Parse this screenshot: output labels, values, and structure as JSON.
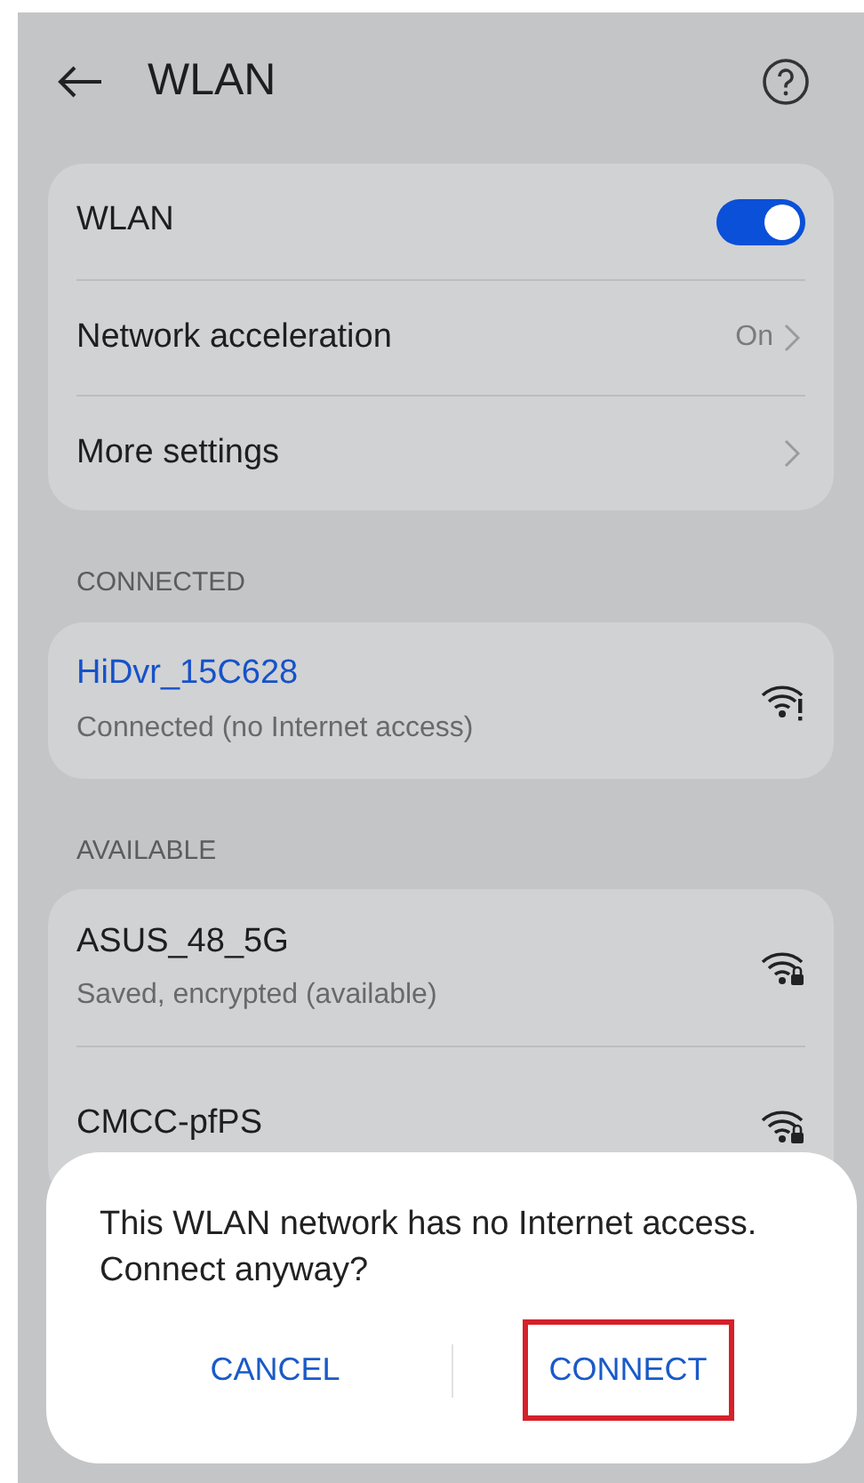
{
  "header": {
    "title": "WLAN"
  },
  "settings": [
    {
      "kind": "toggle",
      "label": "WLAN",
      "on": true
    },
    {
      "kind": "link",
      "label": "Network acceleration",
      "value": "On"
    },
    {
      "kind": "link",
      "label": "More settings"
    }
  ],
  "connected": {
    "heading": "CONNECTED",
    "networks": [
      {
        "name": "HiDvr_15C628",
        "status": "Connected (no Internet access)",
        "kind": "alert",
        "active": true
      }
    ]
  },
  "available": {
    "heading": "AVAILABLE",
    "networks": [
      {
        "name": "ASUS_48_5G",
        "status": "Saved, encrypted (available)",
        "kind": "lock",
        "active": false
      },
      {
        "name": "CMCC-pfPS",
        "kind": "lock",
        "active": false
      }
    ]
  },
  "dialog": {
    "message": "This WLAN network has no Internet access. Connect anyway?",
    "buttons": [
      {
        "label": "CANCEL",
        "highlighted": false
      },
      {
        "label": "CONNECT",
        "highlighted": true
      }
    ]
  }
}
